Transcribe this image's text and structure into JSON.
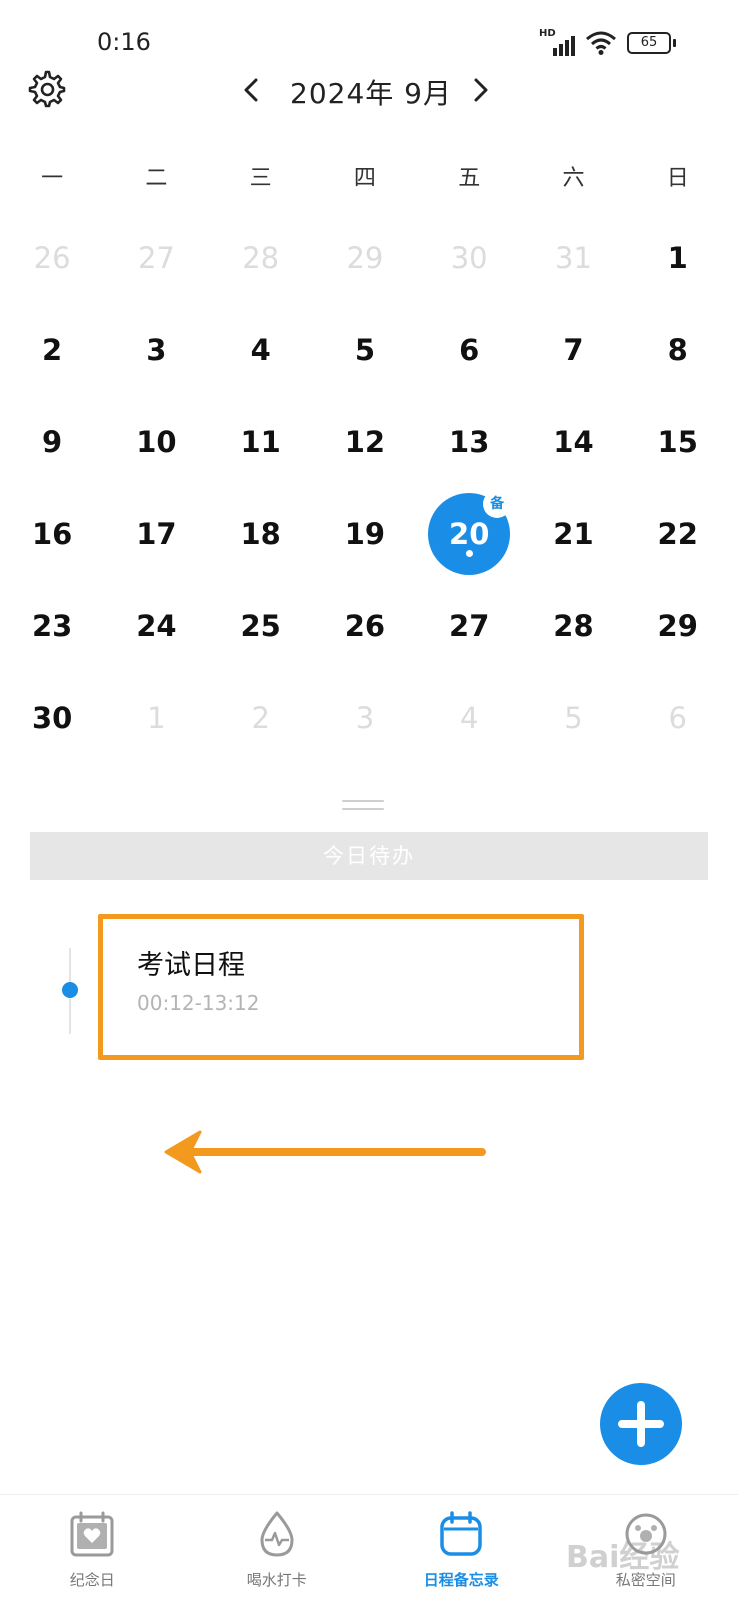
{
  "status_bar": {
    "time": "0:16",
    "network": "HD",
    "battery": "65"
  },
  "header": {
    "month_title": "2024年 9月",
    "prev_glyph": "<",
    "next_glyph": ">"
  },
  "weekdays": [
    "一",
    "二",
    "三",
    "四",
    "五",
    "六",
    "日"
  ],
  "calendar": {
    "weeks": [
      [
        "26",
        "27",
        "28",
        "29",
        "30",
        "31",
        "1"
      ],
      [
        "2",
        "3",
        "4",
        "5",
        "6",
        "7",
        "8"
      ],
      [
        "9",
        "10",
        "11",
        "12",
        "13",
        "14",
        "15"
      ],
      [
        "16",
        "17",
        "18",
        "19",
        "20",
        "21",
        "22"
      ],
      [
        "23",
        "24",
        "25",
        "26",
        "27",
        "28",
        "29"
      ],
      [
        "30",
        "1",
        "2",
        "3",
        "4",
        "5",
        "6"
      ]
    ],
    "selected": "20",
    "memo_badge": "备"
  },
  "todo_section": {
    "title": "今日待办"
  },
  "events": [
    {
      "title": "考试日程",
      "time": "00:12-13:12"
    }
  ],
  "bottom_nav": {
    "tabs": [
      {
        "label": "纪念日",
        "icon": "calendar-heart-icon"
      },
      {
        "label": "喝水打卡",
        "icon": "water-drop-icon"
      },
      {
        "label": "日程备忘录",
        "icon": "schedule-calendar-icon"
      },
      {
        "label": "私密空间",
        "icon": "private-space-icon"
      }
    ],
    "active_index": 2
  },
  "watermark": "Bai经验",
  "colors": {
    "accent": "#1a8ee6",
    "highlight": "#f39a1e",
    "muted": "#dcdcdc"
  }
}
